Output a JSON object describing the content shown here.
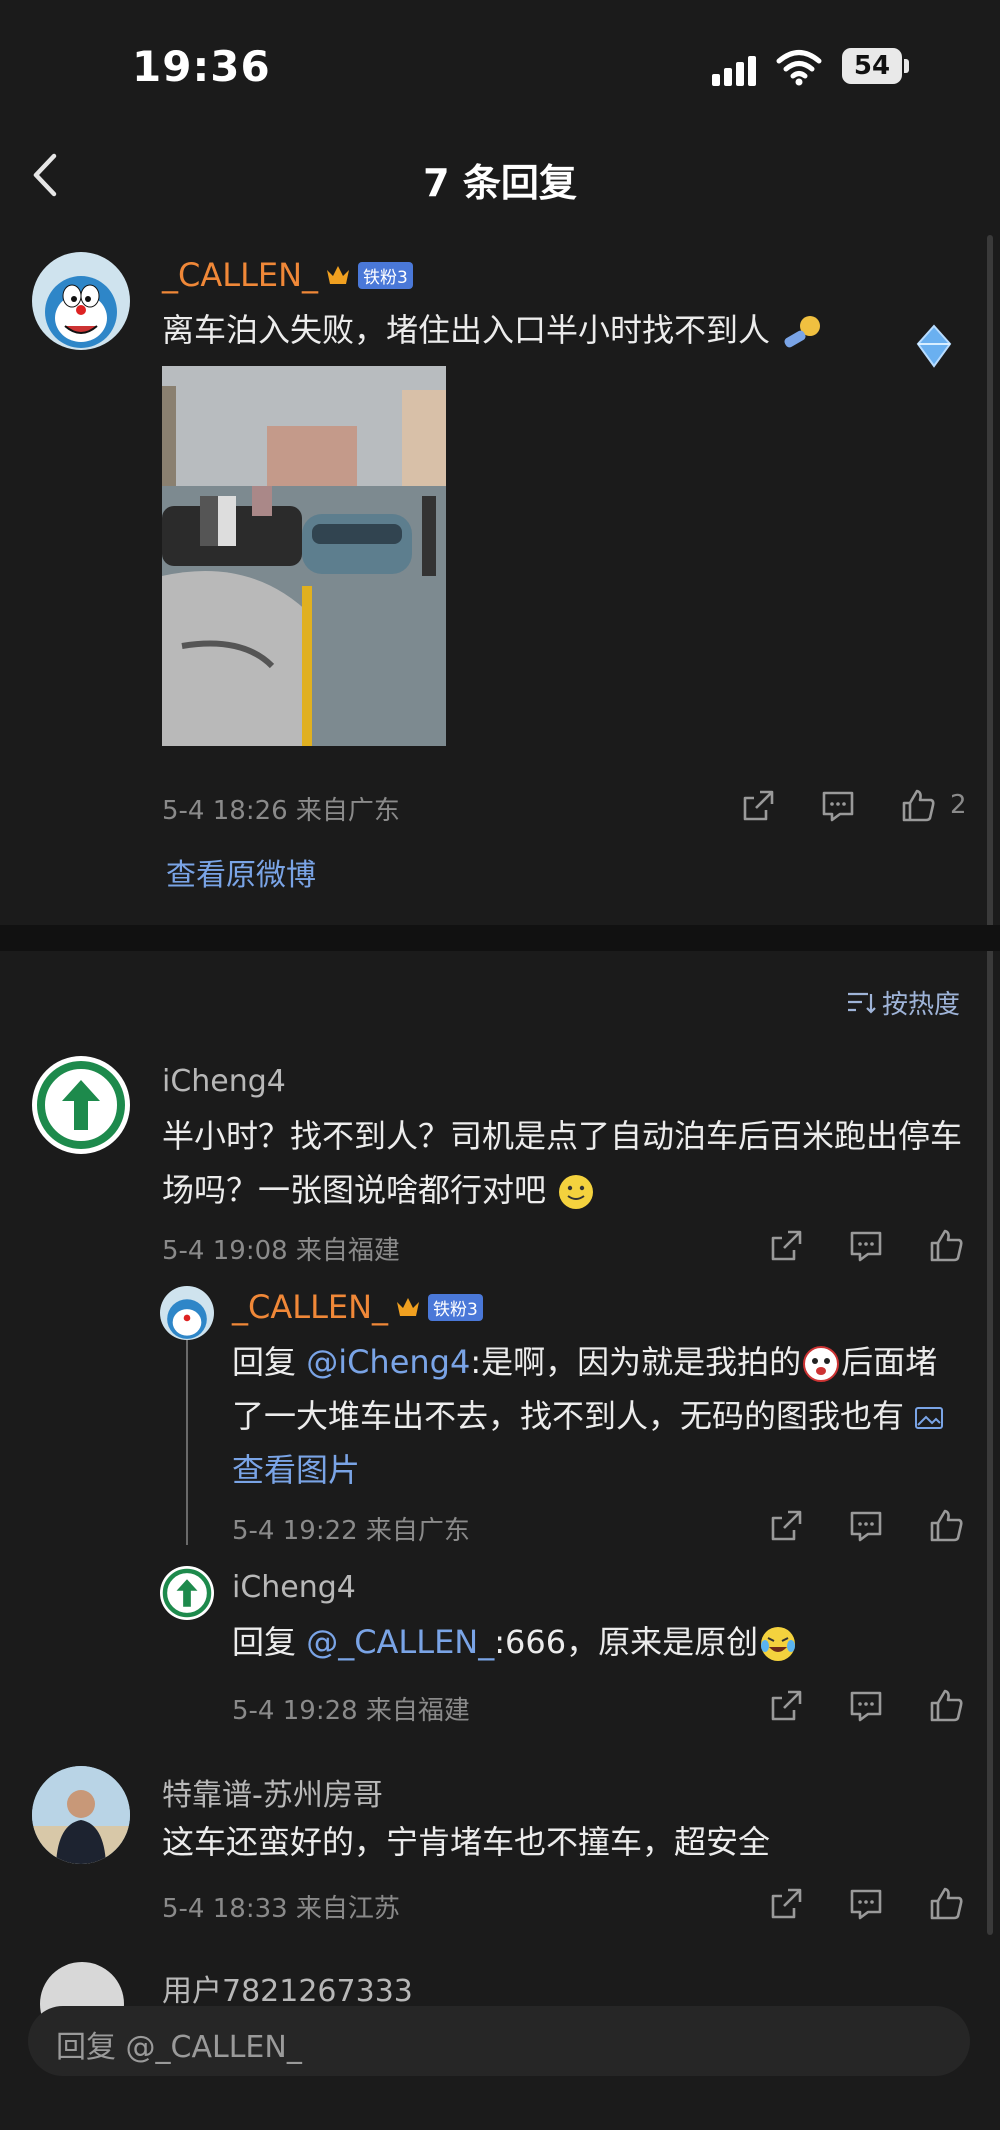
{
  "status_bar": {
    "time": "19:36",
    "battery": "54"
  },
  "header": {
    "title": "7 条回复"
  },
  "main_post": {
    "username": "_CALLEN_",
    "badge": "铁粉3",
    "text": "离车泊入失败，堵住出入口半小时找不到人",
    "meta": "5-4 18:26  来自广东",
    "like_count": "2",
    "view_original": "查看原微博"
  },
  "sort_label": "按热度",
  "comments": [
    {
      "username": "iCheng4",
      "text": "半小时？找不到人？司机是点了自动泊车后百米跑出停车场吗？一张图说啥都行对吧",
      "meta": "5-4 19:08  来自福建",
      "replies": [
        {
          "username": "_CALLEN_",
          "badge": "铁粉3",
          "prefix": "回复 ",
          "mention": "@iCheng4",
          "text": ":是啊，因为就是我拍的",
          "text2": "后面堵了一大堆车出不去，找不到人，无码的图我也有 ",
          "image_link": "查看图片",
          "meta": "5-4 19:22  来自广东"
        },
        {
          "username": "iCheng4",
          "prefix": "回复 ",
          "mention": "@_CALLEN_",
          "text": ":666，原来是原创",
          "meta": "5-4 19:28  来自福建"
        }
      ]
    },
    {
      "username": "特靠谱-苏州房哥",
      "text": "这车还蛮好的，宁肯堵车也不撞车，超安全",
      "meta": "5-4 18:33  来自江苏"
    },
    {
      "username": "用户7821267333"
    }
  ],
  "reply_input": {
    "placeholder": "回复 @_CALLEN_"
  },
  "colors": {
    "background": "#1b1b1b",
    "username_highlight": "#f08838",
    "link": "#7aa4e6",
    "badge": "#4a78d8"
  },
  "icons": [
    "back-icon",
    "share-icon",
    "comment-icon",
    "like-icon",
    "sort-icon",
    "image-icon",
    "crown-icon"
  ]
}
